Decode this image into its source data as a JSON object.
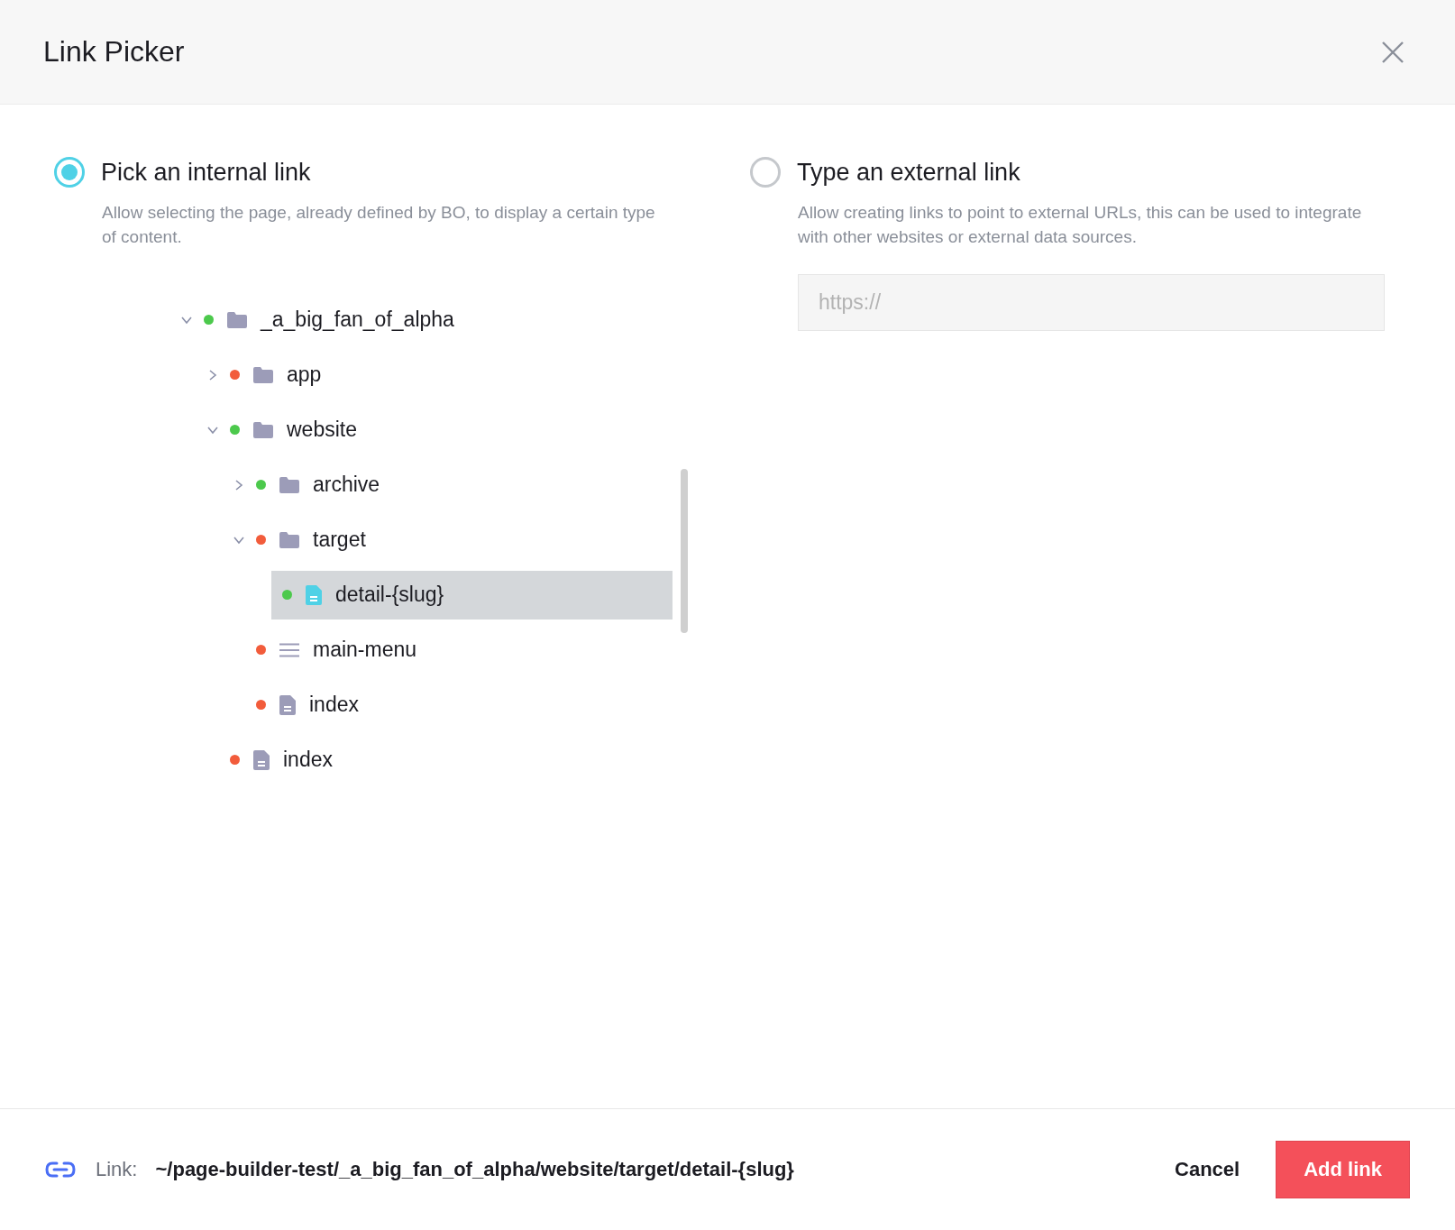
{
  "dialog": {
    "title": "Link Picker"
  },
  "options": [
    {
      "label": "Pick an internal link",
      "selected": true,
      "description": "Allow selecting the page, already defined by BO, to display a certain type of content."
    },
    {
      "label": "Type an external link",
      "selected": false,
      "description": "Allow creating links to point to external URLs, this can be used to integrate with other websites or external data sources."
    }
  ],
  "url_field": {
    "placeholder": "https://"
  },
  "tree": [
    {
      "label": "_a_big_fan_of_alpha",
      "kind": "folder",
      "color": "#4cc94c",
      "expanded": true,
      "selected": false,
      "children": [
        {
          "label": "app",
          "kind": "folder",
          "color": "#f25c3b",
          "expanded": false,
          "selected": false
        },
        {
          "label": "website",
          "kind": "folder",
          "color": "#4cc94c",
          "expanded": true,
          "selected": false,
          "children": [
            {
              "label": "archive",
              "kind": "folder",
              "color": "#4cc94c",
              "expanded": false,
              "selected": false
            },
            {
              "label": "target",
              "kind": "folder",
              "color": "#f25c3b",
              "expanded": true,
              "selected": false,
              "children": [
                {
                  "label": "detail-{slug}",
                  "kind": "page",
                  "color": "#4cc94c",
                  "selected": true
                }
              ]
            },
            {
              "label": "main-menu",
              "kind": "menu",
              "color": "#f25c3b",
              "selected": false
            },
            {
              "label": "index",
              "kind": "page",
              "color": "#f25c3b",
              "selected": false
            }
          ]
        },
        {
          "label": "index",
          "kind": "page",
          "color": "#f25c3b",
          "selected": false
        }
      ]
    }
  ],
  "footer": {
    "link_label": "Link:",
    "link_path": "~/page-builder-test/_a_big_fan_of_alpha/website/target/detail-{slug}",
    "buttons": [
      {
        "label": "Cancel",
        "kind": "secondary"
      },
      {
        "label": "Add link",
        "kind": "primary"
      }
    ]
  }
}
